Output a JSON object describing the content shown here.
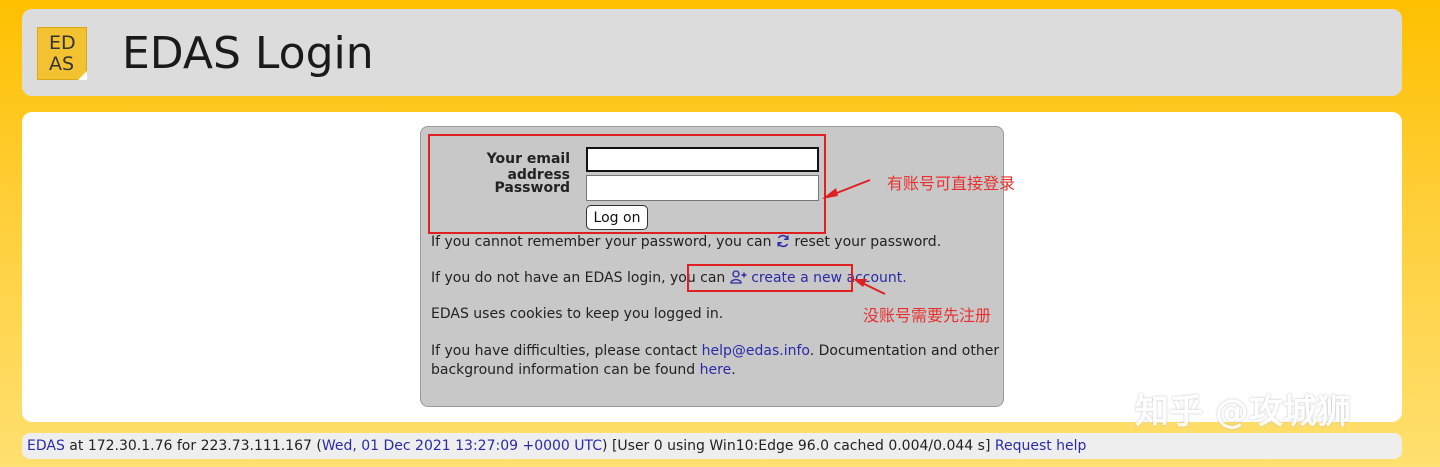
{
  "header": {
    "logo_line1": "ED",
    "logo_line2": "AS",
    "title": "EDAS Login"
  },
  "login_form": {
    "email_label": "Your email address",
    "email_value": "",
    "password_label": "Password",
    "password_value": "",
    "submit_label": "Log on"
  },
  "messages": {
    "reset_prefix": "If you cannot remember your password, you can",
    "reset_link": "reset your password.",
    "create_prefix": "If you do not have an EDAS login, you can",
    "create_link": "create a new account.",
    "cookies": "EDAS uses cookies to keep you logged in.",
    "help_prefix": "If you have difficulties, please contact",
    "help_email": "help@edas.info",
    "help_mid": ". Documentation and other",
    "help_line2_prefix": "background information can be found",
    "help_here": "here",
    "help_suffix": "."
  },
  "annotations": {
    "login_note": "有账号可直接登录",
    "register_note": "没账号需要先注册",
    "color": "#e02020"
  },
  "footer": {
    "edas_link": "EDAS",
    "server_text": " at 172.30.1.76 for 223.73.111.167 (",
    "timestamp": "Wed, 01 Dec 2021 13:27:09 +0000 UTC",
    "user_info": ") [User 0 using Win10:Edge 96.0 cached 0.004/0.044 s] ",
    "request_help": "Request help"
  },
  "watermark": "知乎 @攻城狮",
  "icons": {
    "reset": "refresh-icon",
    "create": "add-user-icon"
  },
  "colors": {
    "background": "#ffc000",
    "link": "#2a2aa8",
    "panel": "#c8c8c8"
  }
}
